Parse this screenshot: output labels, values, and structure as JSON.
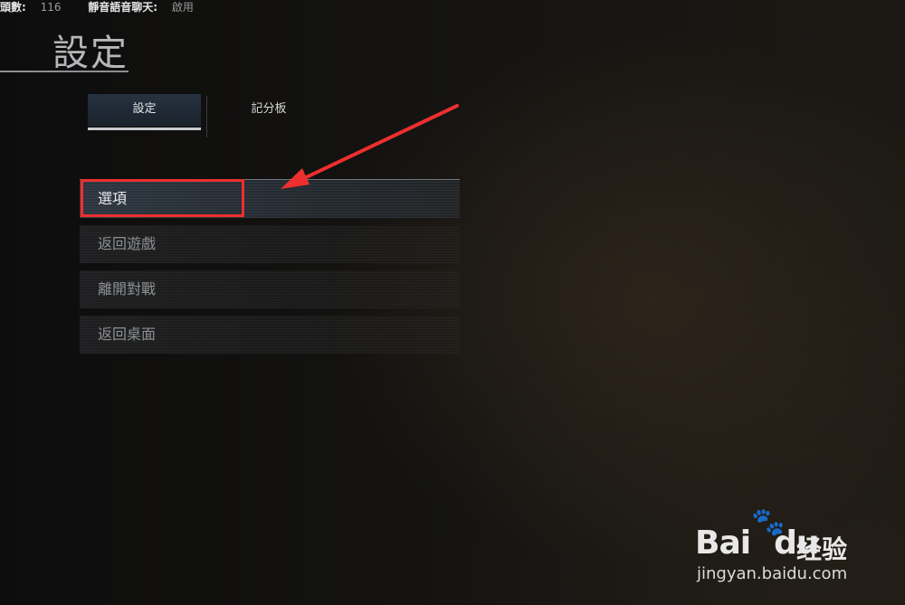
{
  "statusbar": {
    "ping_label": "頭數:",
    "ping_value": "116",
    "mute_label": "靜音語音聊天:",
    "mute_value": "啟用"
  },
  "header": {
    "title": "設定"
  },
  "tabs": [
    {
      "label": "設定",
      "active": true
    },
    {
      "label": "記分板",
      "active": false
    }
  ],
  "menu": {
    "items": [
      {
        "label": "選項",
        "highlighted": true
      },
      {
        "label": "返回遊戲"
      },
      {
        "label": "離開對戰"
      },
      {
        "label": "返回桌面"
      }
    ]
  },
  "annotation": {
    "color": "#ee2f2f"
  },
  "watermark": {
    "brand": "Bai",
    "brand_du": "du",
    "cn": "经验",
    "url": "jingyan.baidu.com",
    "paw_icon": "paw-icon"
  }
}
